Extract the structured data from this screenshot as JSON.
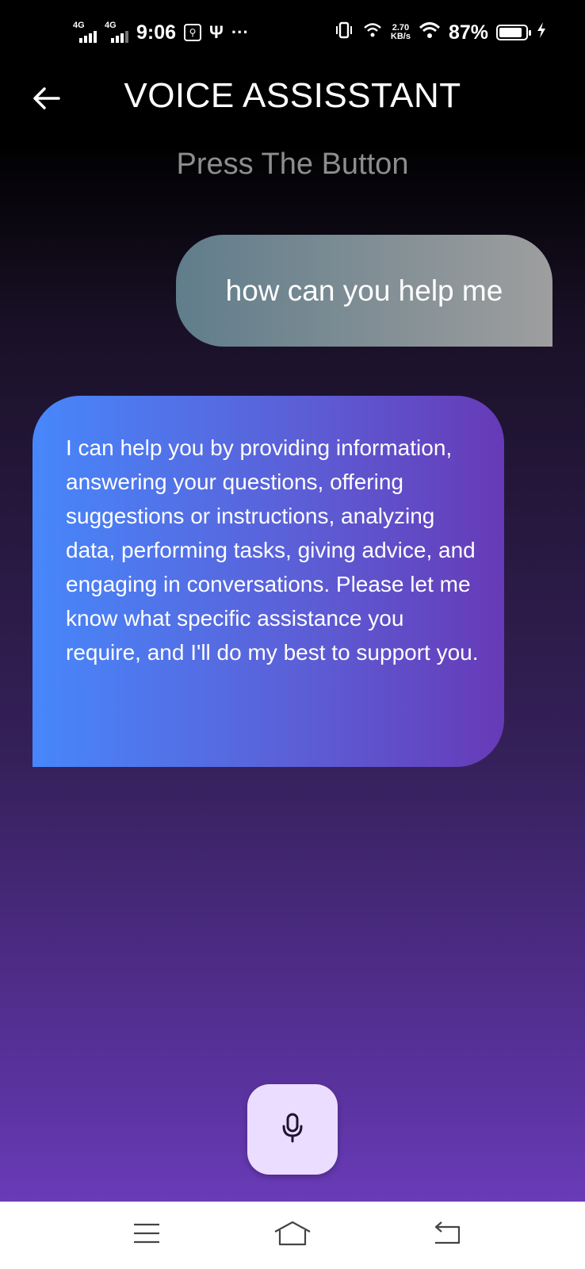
{
  "status_bar": {
    "net1": "4G",
    "net2": "4G",
    "time": "9:06",
    "more": "···",
    "speed_value": "2.70",
    "speed_unit": "KB/s",
    "battery": "87%"
  },
  "header": {
    "title": "VOICE ASSISSTANT",
    "subtitle": "Press The Button"
  },
  "messages": [
    {
      "role": "user",
      "text": "how can you help me"
    },
    {
      "role": "assistant",
      "text": "I can help you by providing information, answering your questions, offering suggestions or instructions, analyzing data, performing tasks, giving advice, and engaging in conversations. Please let me know what specific assistance you require, and I'll do my best to support you."
    }
  ],
  "colors": {
    "user_bubble_start": "#607d8b",
    "user_bubble_end": "#9e9e9e",
    "assistant_bubble_start": "#4787fb",
    "assistant_bubble_end": "#673ab7",
    "mic_button_bg": "#ebddff",
    "subtitle": "#8d8d8d"
  },
  "icons": {
    "back": "arrow-left-icon",
    "mic": "microphone-icon",
    "nav_menu": "menu-icon",
    "nav_home": "home-icon",
    "nav_back": "back-icon"
  }
}
